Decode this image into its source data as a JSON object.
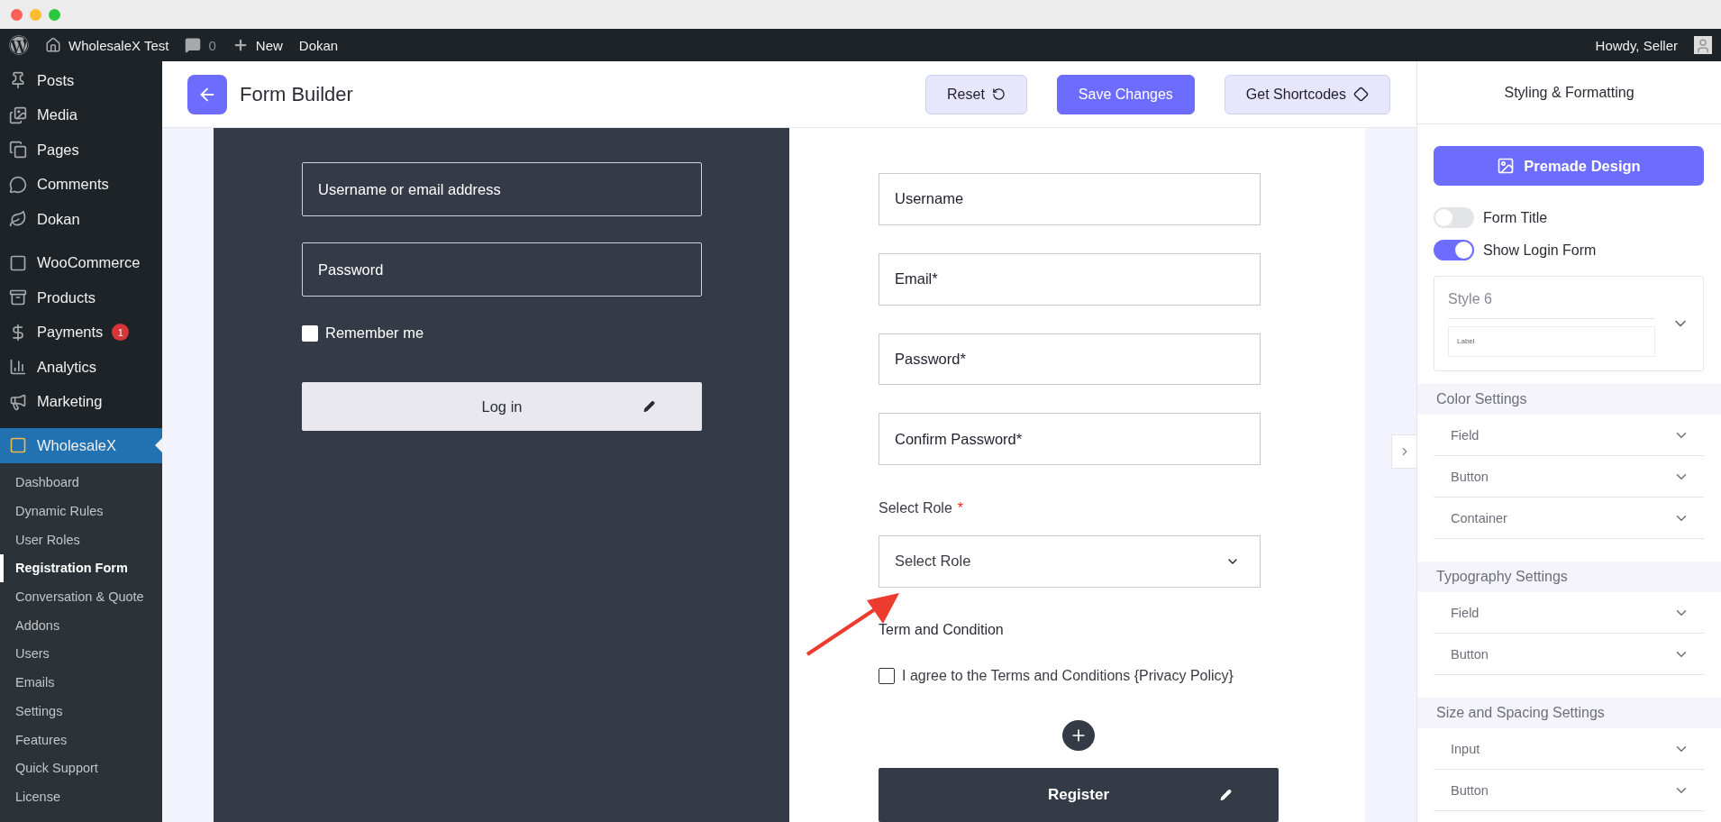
{
  "admin_bar": {
    "site": "WholesaleX Test",
    "comments": "0",
    "new": "New",
    "dokan": "Dokan",
    "greeting": "Howdy, Seller"
  },
  "sidebar": {
    "items": [
      {
        "label": "Posts",
        "selected": false
      },
      {
        "label": "Media",
        "selected": false
      },
      {
        "label": "Pages",
        "selected": false
      },
      {
        "label": "Comments",
        "selected": false
      },
      {
        "label": "Dokan",
        "selected": false
      },
      {
        "label": "WooCommerce",
        "selected": false
      },
      {
        "label": "Products",
        "selected": false
      },
      {
        "label": "Payments",
        "selected": false,
        "badge": "1"
      },
      {
        "label": "Analytics",
        "selected": false
      },
      {
        "label": "Marketing",
        "selected": false
      },
      {
        "label": "WholesaleX",
        "selected": true
      }
    ],
    "submenu": [
      {
        "label": "Dashboard",
        "selected": false
      },
      {
        "label": "Dynamic Rules",
        "selected": false
      },
      {
        "label": "User Roles",
        "selected": false
      },
      {
        "label": "Registration Form",
        "selected": true
      },
      {
        "label": "Conversation & Quote",
        "selected": false
      },
      {
        "label": "Addons",
        "selected": false
      },
      {
        "label": "Users",
        "selected": false
      },
      {
        "label": "Emails",
        "selected": false
      },
      {
        "label": "Settings",
        "selected": false
      },
      {
        "label": "Features",
        "selected": false
      },
      {
        "label": "Quick Support",
        "selected": false
      },
      {
        "label": "License",
        "selected": false
      }
    ]
  },
  "header": {
    "title": "Form Builder",
    "buttons": [
      {
        "label": "Reset",
        "kind": "reset"
      },
      {
        "label": "Save Changes",
        "kind": "primary"
      },
      {
        "label": "Get Shortcodes",
        "kind": "shortcode"
      }
    ]
  },
  "login_form": {
    "fields": [
      {
        "placeholder": "Username or email address"
      },
      {
        "placeholder": "Password"
      }
    ],
    "remember": {
      "label": "Remember me",
      "checked": false
    },
    "button": "Log in"
  },
  "register_form": {
    "fields": [
      {
        "placeholder": "Username"
      },
      {
        "placeholder": "Email*"
      },
      {
        "placeholder": "Password*"
      },
      {
        "placeholder": "Confirm Password*"
      }
    ],
    "role": {
      "label": "Select Role",
      "required": "*",
      "placeholder": "Select Role"
    },
    "terms": {
      "title": "Term and Condition",
      "label": "I agree to the Terms and Conditions {Privacy Policy}",
      "checked": false
    },
    "button": "Register"
  },
  "styling_panel": {
    "title": "Styling & Formatting",
    "premade": "Premade Design",
    "toggles": [
      {
        "label": "Form Title",
        "on": false
      },
      {
        "label": "Show Login Form",
        "on": true
      }
    ],
    "style": {
      "name": "Style 6",
      "preview": "Label"
    },
    "sections": [
      {
        "title": "Color Settings",
        "items": [
          {
            "label": "Field",
            "expanded": false
          },
          {
            "label": "Button",
            "expanded": false
          },
          {
            "label": "Container",
            "expanded": false
          }
        ]
      },
      {
        "title": "Typography Settings",
        "items": [
          {
            "label": "Field",
            "expanded": false
          },
          {
            "label": "Button",
            "expanded": false
          }
        ]
      },
      {
        "title": "Size and Spacing Settings",
        "items": [
          {
            "label": "Input",
            "expanded": false
          },
          {
            "label": "Button",
            "expanded": false
          }
        ]
      }
    ]
  }
}
